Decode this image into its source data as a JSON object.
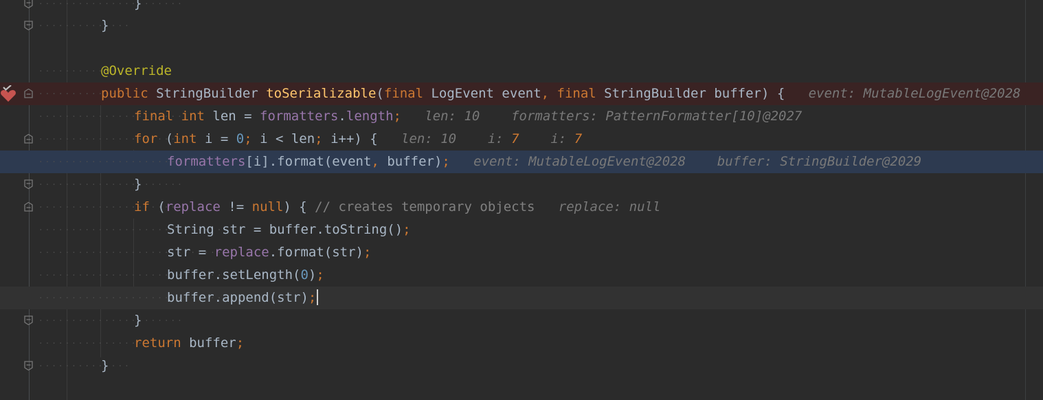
{
  "editor": {
    "lines": [
      {
        "tokens": [
          {
            "t": "}",
            "c": "plain"
          }
        ]
      },
      {
        "tokens": [
          {
            "t": "}",
            "c": "plain"
          }
        ]
      },
      {
        "tokens": []
      },
      {
        "tokens": [
          {
            "t": "@Override",
            "c": "ann"
          }
        ]
      },
      {
        "tokens": [
          {
            "t": "public ",
            "c": "kw"
          },
          {
            "t": "StringBuilder ",
            "c": "plain"
          },
          {
            "t": "toSerializable",
            "c": "fn"
          },
          {
            "t": "(",
            "c": "plain"
          },
          {
            "t": "final ",
            "c": "kw"
          },
          {
            "t": "LogEvent event",
            "c": "plain"
          },
          {
            "t": ", ",
            "c": "kw"
          },
          {
            "t": "final ",
            "c": "kw"
          },
          {
            "t": "StringBuilder buffer) {",
            "c": "plain"
          },
          {
            "t": "   event: MutableLogEvent@2028",
            "c": "inlay"
          }
        ]
      },
      {
        "tokens": [
          {
            "t": "final int ",
            "c": "kw"
          },
          {
            "t": "len = ",
            "c": "plain"
          },
          {
            "t": "formatters",
            "c": "field"
          },
          {
            "t": ".",
            "c": "plain"
          },
          {
            "t": "length",
            "c": "field"
          },
          {
            "t": ";",
            "c": "kw"
          },
          {
            "t": "   len: 10    formatters: PatternFormatter[10]@2027",
            "c": "inlay"
          }
        ]
      },
      {
        "tokens": [
          {
            "t": "for ",
            "c": "kw"
          },
          {
            "t": "(",
            "c": "plain"
          },
          {
            "t": "int ",
            "c": "kw"
          },
          {
            "t": "i = ",
            "c": "plain"
          },
          {
            "t": "0",
            "c": "num"
          },
          {
            "t": "; ",
            "c": "kw"
          },
          {
            "t": "i < len",
            "c": "plain"
          },
          {
            "t": "; ",
            "c": "kw"
          },
          {
            "t": "i++) {",
            "c": "plain"
          },
          {
            "t": "   len: 10    i: ",
            "c": "inlay"
          },
          {
            "t": "7",
            "c": "inlay-num"
          },
          {
            "t": "    i: ",
            "c": "inlay"
          },
          {
            "t": "7",
            "c": "inlay-num"
          }
        ]
      },
      {
        "tokens": [
          {
            "t": "formatters",
            "c": "field"
          },
          {
            "t": "[i].format(event",
            "c": "plain"
          },
          {
            "t": ", ",
            "c": "kw"
          },
          {
            "t": "buffer)",
            "c": "plain"
          },
          {
            "t": ";",
            "c": "kw"
          },
          {
            "t": "   event: MutableLogEvent@2028    buffer: StringBuilder@2029",
            "c": "inlay"
          }
        ]
      },
      {
        "tokens": [
          {
            "t": "}",
            "c": "plain"
          }
        ]
      },
      {
        "tokens": [
          {
            "t": "if ",
            "c": "kw"
          },
          {
            "t": "(",
            "c": "plain"
          },
          {
            "t": "replace",
            "c": "field"
          },
          {
            "t": " != ",
            "c": "plain"
          },
          {
            "t": "null",
            "c": "kw"
          },
          {
            "t": ") { ",
            "c": "plain"
          },
          {
            "t": "// creates temporary objects",
            "c": "cmt"
          },
          {
            "t": "   replace: null",
            "c": "inlay"
          }
        ]
      },
      {
        "tokens": [
          {
            "t": "String str = buffer.toString()",
            "c": "plain"
          },
          {
            "t": ";",
            "c": "kw"
          }
        ]
      },
      {
        "tokens": [
          {
            "t": "str = ",
            "c": "plain"
          },
          {
            "t": "replace",
            "c": "field"
          },
          {
            "t": ".format(str)",
            "c": "plain"
          },
          {
            "t": ";",
            "c": "kw"
          }
        ]
      },
      {
        "tokens": [
          {
            "t": "buffer.setLength(",
            "c": "plain"
          },
          {
            "t": "0",
            "c": "num"
          },
          {
            "t": ")",
            "c": "plain"
          },
          {
            "t": ";",
            "c": "kw"
          }
        ]
      },
      {
        "tokens": [
          {
            "t": "buffer.append(str)",
            "c": "plain"
          },
          {
            "t": ";",
            "c": "kw"
          }
        ]
      },
      {
        "tokens": [
          {
            "t": "}",
            "c": "plain"
          }
        ]
      },
      {
        "tokens": [
          {
            "t": "return ",
            "c": "kw"
          },
          {
            "t": "buffer",
            "c": "plain"
          },
          {
            "t": ";",
            "c": "kw"
          }
        ]
      },
      {
        "tokens": [
          {
            "t": "}",
            "c": "plain"
          }
        ]
      }
    ]
  },
  "colors": {
    "background": "#2b2b2b",
    "breakpoint_line": "#3a2323",
    "execution_line": "#2d3a50",
    "caret_line": "#323232",
    "breakpoint_icon": "#c75450"
  },
  "icons": {
    "breakpoint": "breakpoint-check-icon",
    "fold": "fold-marker-icon"
  }
}
